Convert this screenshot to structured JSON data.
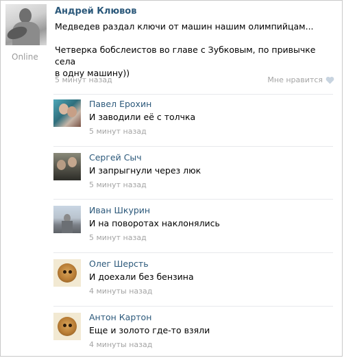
{
  "post": {
    "author": "Андрей Клювов",
    "status": "Online",
    "text_line1": "Медведев раздал ключи от машин нашим олимпийцам...",
    "text_line2": "Четверка бобслеистов во главе с Зубковым, по привычке села",
    "text_line3": "в одну машину))",
    "time": "5 минут назад",
    "like_label": "Мне нравится"
  },
  "comments": [
    {
      "name": "Павел Ерохин",
      "text": "И заводили её с толчка",
      "time": "5 минут назад"
    },
    {
      "name": "Сергей Сыч",
      "text": "И запрыгнули через люк",
      "time": "5 минут назад"
    },
    {
      "name": "Иван Шкурин",
      "text": "И на поворотах наклонялись",
      "time": "5 минут назад"
    },
    {
      "name": "Олег Шерсть",
      "text": "И доехали без бензина",
      "time": "4 минуты назад"
    },
    {
      "name": "Антон Картон",
      "text": "Еще и золото где-то взяли",
      "time": "4 минуты назад"
    }
  ],
  "colors": {
    "link": "#2b587a",
    "muted": "#a4a4a4",
    "divider": "#e7e8ec"
  },
  "icons": {
    "like": "heart-icon"
  }
}
